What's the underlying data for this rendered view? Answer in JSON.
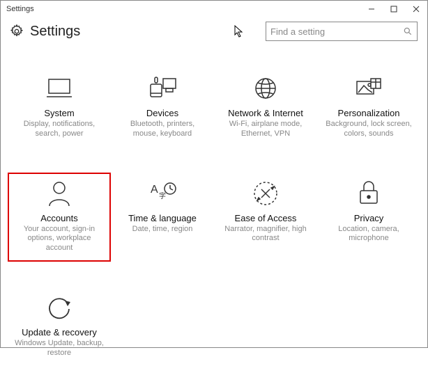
{
  "window": {
    "title": "Settings"
  },
  "header": {
    "title": "Settings"
  },
  "search": {
    "placeholder": "Find a setting"
  },
  "tiles": {
    "system": {
      "title": "System",
      "desc": "Display, notifications, search, power"
    },
    "devices": {
      "title": "Devices",
      "desc": "Bluetooth, printers, mouse, keyboard"
    },
    "network": {
      "title": "Network & Internet",
      "desc": "Wi-Fi, airplane mode, Ethernet, VPN"
    },
    "personal": {
      "title": "Personalization",
      "desc": "Background, lock screen, colors, sounds"
    },
    "accounts": {
      "title": "Accounts",
      "desc": "Your account, sign-in options, workplace account"
    },
    "time": {
      "title": "Time & language",
      "desc": "Date, time, region"
    },
    "ease": {
      "title": "Ease of Access",
      "desc": "Narrator, magnifier, high contrast"
    },
    "privacy": {
      "title": "Privacy",
      "desc": "Location, camera, microphone"
    },
    "update": {
      "title": "Update & recovery",
      "desc": "Windows Update, backup, restore"
    }
  }
}
